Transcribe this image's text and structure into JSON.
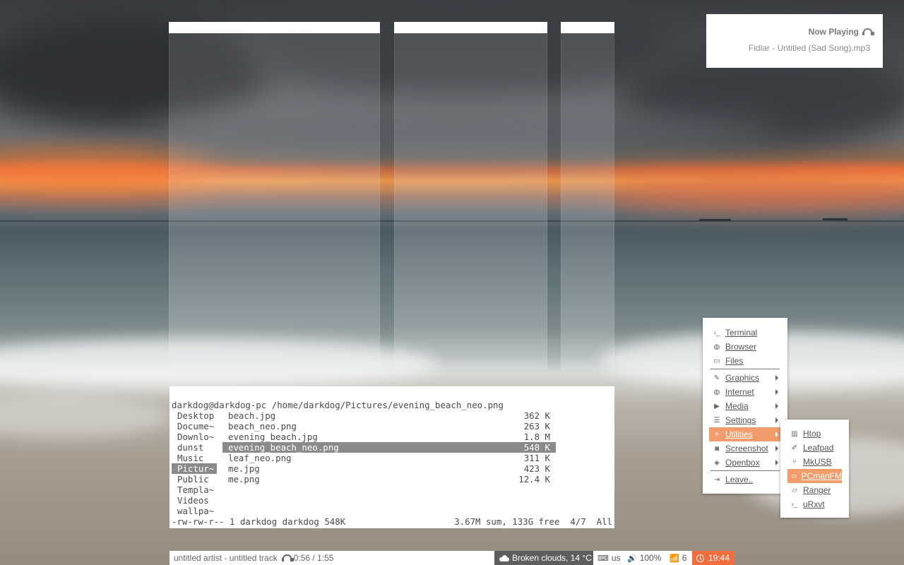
{
  "now_playing": {
    "title": "Now Playing",
    "track": "Fidlar - Untitled (Sad Song).mp3",
    "icon": "headphone-icon"
  },
  "terminal": {
    "header": "darkdog@darkdog-pc /home/darkdog/Pictures/evening_beach_neo.png",
    "dirs": [
      "Desktop",
      "Docume~",
      "Downlo~",
      "dunst",
      "Music",
      "Pictur~",
      "Public",
      "Templa~",
      "Videos",
      "wallpa~"
    ],
    "active_dir_index": 5,
    "files": [
      {
        "name": "beach.jpg",
        "size": "362 K"
      },
      {
        "name": "beach_neo.png",
        "size": "263 K"
      },
      {
        "name": "evening_beach.jpg",
        "size": "1.8 M"
      },
      {
        "name": "evening_beach_neo.png",
        "size": "548 K"
      },
      {
        "name": "leaf_neo.png",
        "size": "311 K"
      },
      {
        "name": "me.jpg",
        "size": "423 K"
      },
      {
        "name": "me.png",
        "size": "12.4 K"
      }
    ],
    "active_file_index": 3,
    "status_left": "-rw-rw-r-- 1 darkdog darkdog 548K",
    "status_right": "3.67M sum, 133G free  4/7  All"
  },
  "menu": {
    "items": [
      {
        "label": "Terminal",
        "icon": ">_",
        "submenu": false
      },
      {
        "label": "Browser",
        "icon": "globe",
        "submenu": false
      },
      {
        "label": "Files",
        "icon": "folder",
        "submenu": false
      },
      {
        "label": "Graphics",
        "icon": "brush",
        "submenu": true
      },
      {
        "label": "Internet",
        "icon": "globe",
        "submenu": true
      },
      {
        "label": "Media",
        "icon": "play",
        "submenu": true
      },
      {
        "label": "Settings",
        "icon": "sliders",
        "submenu": true
      },
      {
        "label": "Utilities",
        "icon": "wrench",
        "submenu": true
      },
      {
        "label": "Screenshot",
        "icon": "camera",
        "submenu": true
      },
      {
        "label": "Openbox",
        "icon": "cube",
        "submenu": true
      },
      {
        "label": "Leave..",
        "icon": "logout",
        "submenu": false
      }
    ],
    "highlight_index": 7
  },
  "submenu": {
    "items": [
      {
        "label": "Htop",
        "icon": "chart"
      },
      {
        "label": "Leafpad",
        "icon": "edit"
      },
      {
        "label": "MkUSB",
        "icon": "usb"
      },
      {
        "label": "PCmanFM",
        "icon": "folder-open"
      },
      {
        "label": "Ranger",
        "icon": "folder-open"
      },
      {
        "label": "uRxvt",
        "icon": ">_"
      }
    ],
    "highlight_index": 3
  },
  "bar": {
    "track": "untitled artist - untitled track",
    "time": "0:56 / 1:55",
    "weather": "Broken clouds, 14 °C",
    "keyboard": "us",
    "volume": "100%",
    "wifi": "6",
    "clock": "19:44",
    "accent_color": "#f26d3d"
  }
}
